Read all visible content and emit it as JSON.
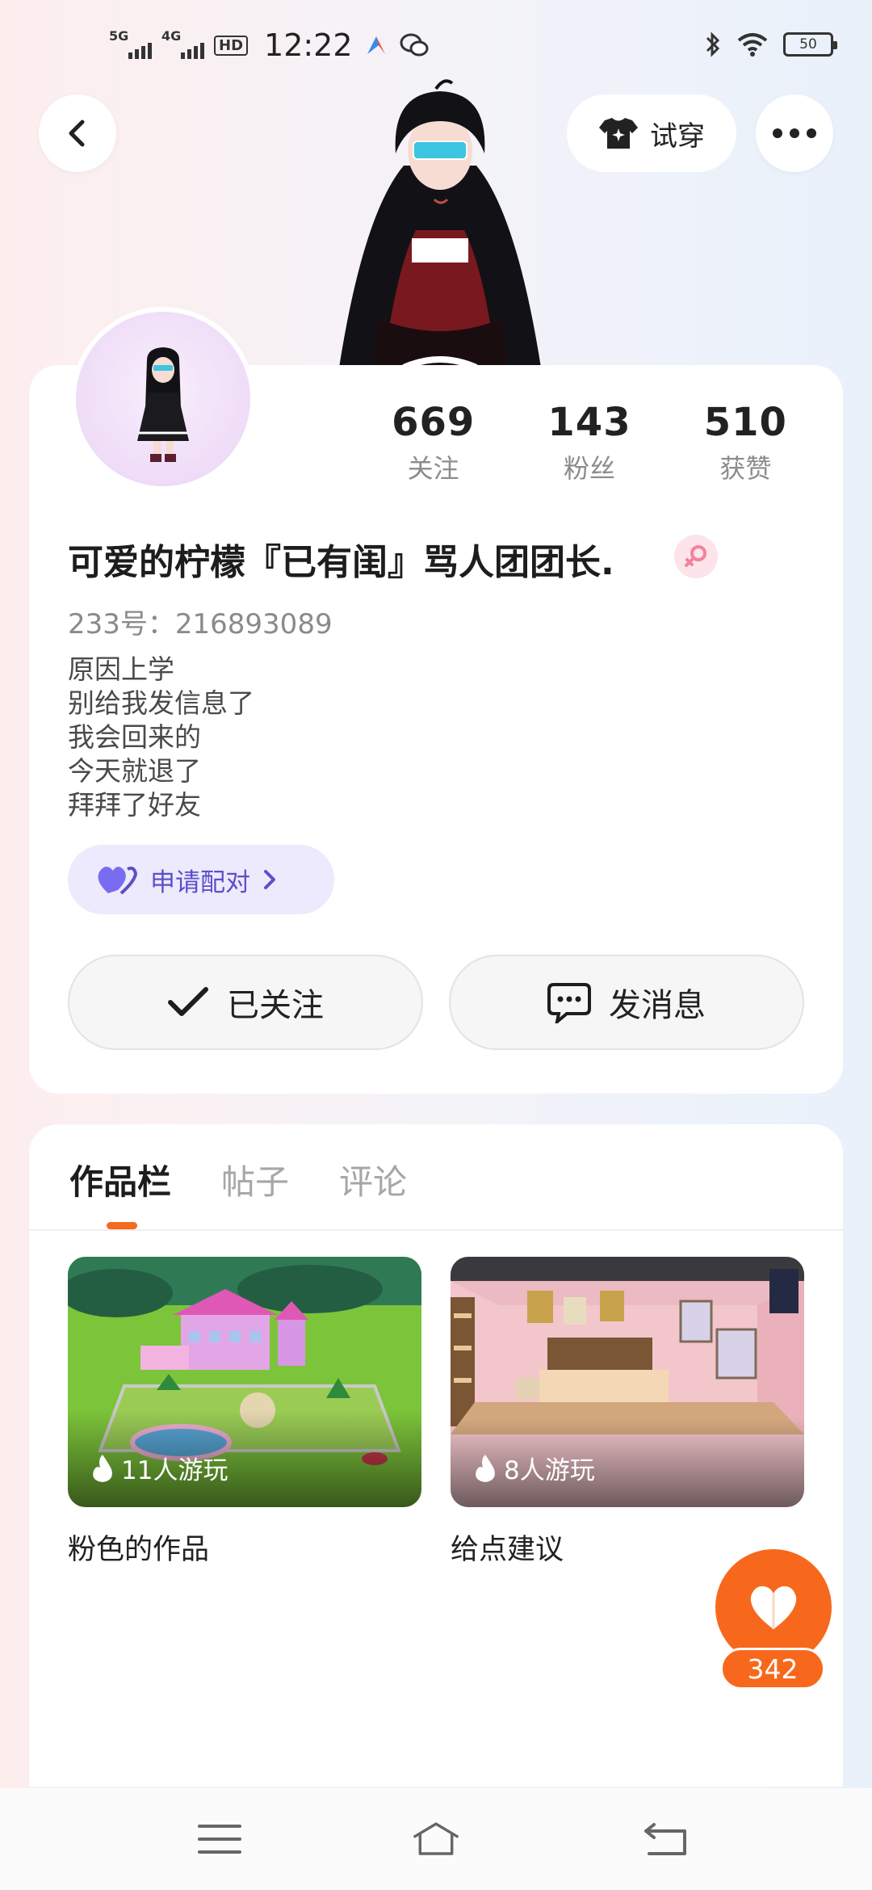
{
  "status_bar": {
    "sim1": "5G",
    "sim2": "4G",
    "hd": "HD",
    "time": "12:22",
    "battery": "50"
  },
  "header": {
    "tryon_label": "试穿"
  },
  "profile": {
    "stats": [
      {
        "value": "669",
        "label": "关注"
      },
      {
        "value": "143",
        "label": "粉丝"
      },
      {
        "value": "510",
        "label": "获赞"
      }
    ],
    "username": "可爱的柠檬『已有闺』骂人团团长.",
    "uid": "233号：216893089",
    "bio": [
      "原因上学",
      "别给我发信息了",
      "我会回来的",
      "今天就退了",
      "拜拜了好友"
    ],
    "pair_label": "申请配对",
    "follow_label": "已关注",
    "message_label": "发消息"
  },
  "tabs": [
    {
      "label": "作品栏",
      "active": true
    },
    {
      "label": "帖子",
      "active": false
    },
    {
      "label": "评论",
      "active": false
    }
  ],
  "works": [
    {
      "title": "粉色的作品",
      "plays": "11人游玩"
    },
    {
      "title": "给点建议",
      "plays": "8人游玩"
    }
  ],
  "like": {
    "count": "342"
  },
  "colors": {
    "accent": "#f8681c",
    "pair": "#5b4fc9",
    "pair_bg": "#eceafc",
    "gender": "#f0839a"
  }
}
